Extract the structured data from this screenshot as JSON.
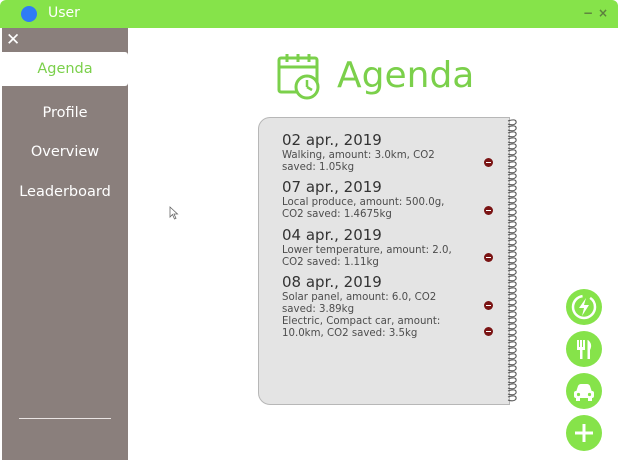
{
  "window": {
    "title": "User",
    "minimize": "−",
    "close": "×"
  },
  "sidebar": {
    "close": "✕",
    "items": [
      {
        "label": "Agenda",
        "active": true
      },
      {
        "label": "Profile",
        "active": false
      },
      {
        "label": "Overview",
        "active": false
      },
      {
        "label": "Leaderboard",
        "active": false
      }
    ]
  },
  "header": {
    "title": "Agenda",
    "icon": "calendar-clock-icon"
  },
  "agenda": [
    {
      "date": "02 apr., 2019",
      "items": [
        "Walking, amount: 3.0km, CO2 saved: 1.05kg"
      ]
    },
    {
      "date": "07 apr., 2019",
      "items": [
        "Local produce, amount: 500.0g, CO2 saved: 1.4675kg"
      ]
    },
    {
      "date": "04 apr., 2019",
      "items": [
        "Lower temperature, amount: 2.0, CO2 saved: 1.11kg"
      ]
    },
    {
      "date": "08 apr., 2019",
      "items": [
        "Solar panel, amount: 6.0, CO2 saved: 3.89kg",
        "Electric, Compact car, amount: 10.0km, CO2 saved: 3.5kg"
      ]
    }
  ],
  "fabs": [
    "energy-icon",
    "food-icon",
    "car-icon",
    "plus-icon"
  ],
  "colors": {
    "accent": "#86e34a",
    "sidebar": "#8a7f7c",
    "remove": "#7a1414"
  }
}
